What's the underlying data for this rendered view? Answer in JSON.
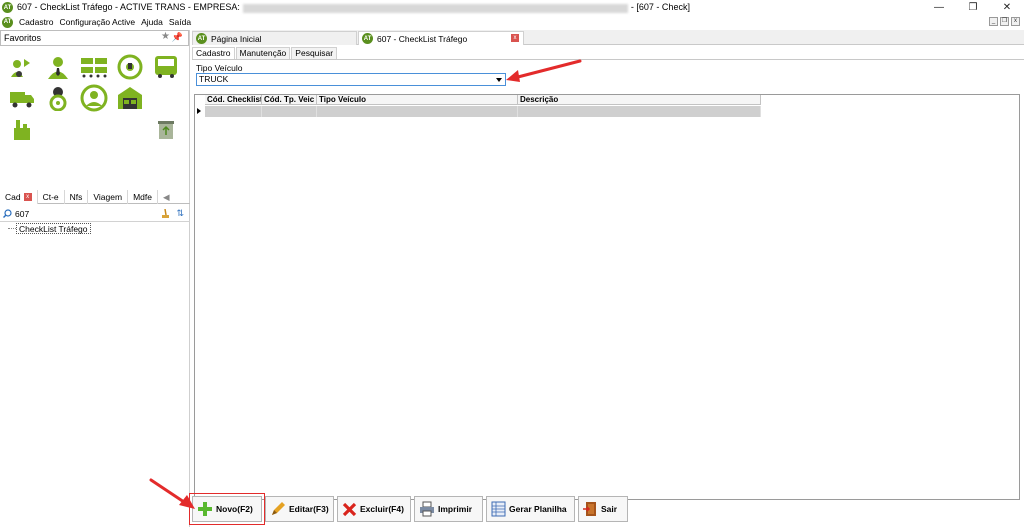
{
  "window": {
    "title_prefix": "607 - CheckList Tráfego - ACTIVE TRANS - EMPRESA:",
    "title_suffix": "- [607 - Check]",
    "logo_text": "AT"
  },
  "menu": {
    "items": [
      "Cadastro",
      "Configuração Active",
      "Ajuda",
      "Saída"
    ]
  },
  "left": {
    "favorites_label": "Favoritos",
    "category_tabs": [
      "Cad",
      "Ct-e",
      "Nfs",
      "Viagem",
      "Mdfe"
    ],
    "search_value": "607",
    "tree_item": "CheckList Tráfego"
  },
  "doc_tabs": {
    "home": "Página Inicial",
    "current": "607 - CheckList Tráfego"
  },
  "sub_tabs": [
    "Cadastro",
    "Manutenção",
    "Pesquisar"
  ],
  "form": {
    "field_label": "Tipo Veículo",
    "field_value": "TRUCK"
  },
  "grid": {
    "columns": [
      "Cód. Checklist",
      "Cód. Tp. Veic",
      "Tipo Veículo",
      "Descrição"
    ]
  },
  "toolbar": {
    "novo": "Novo(F2)",
    "editar": "Editar(F3)",
    "excluir": "Excluir(F4)",
    "imprimir": "Imprimir",
    "gerar": "Gerar Planilha",
    "sair": "Sair"
  },
  "colors": {
    "brand_green": "#7fb321",
    "annotation_red": "#e32b2b",
    "select_border": "#4a90d9"
  }
}
